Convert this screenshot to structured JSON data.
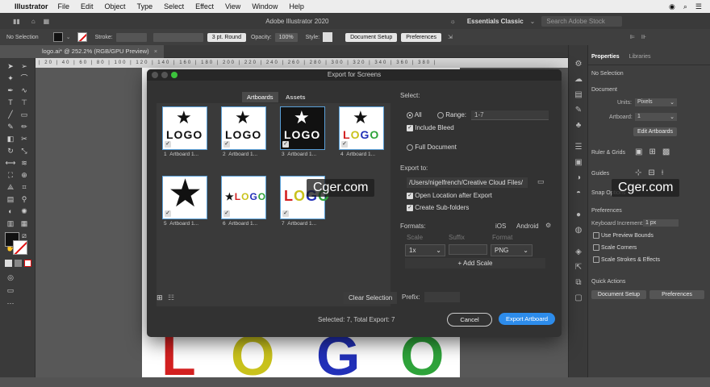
{
  "menubar": {
    "app": "Illustrator",
    "items": [
      "File",
      "Edit",
      "Object",
      "Type",
      "Select",
      "Effect",
      "View",
      "Window",
      "Help"
    ]
  },
  "appbar": {
    "title": "Adobe Illustrator 2020",
    "workspace": "Essentials Classic",
    "search_placeholder": "Search Adobe Stock"
  },
  "control": {
    "selection": "No Selection",
    "stroke_label": "Stroke:",
    "brush": "3 pt. Round",
    "opacity_label": "Opacity:",
    "opacity": "100%",
    "style_label": "Style:",
    "document_setup": "Document Setup",
    "preferences": "Preferences"
  },
  "doc_tab": "logo.ai* @ 252.2% (RGB/GPU Preview)",
  "artboard_letters": {
    "l": "L",
    "o1": "O",
    "g": "G",
    "o2": "O"
  },
  "dialog": {
    "title": "Export for Screens",
    "tabs": [
      "Artboards",
      "Assets"
    ],
    "artboards": [
      {
        "num": "1",
        "label": "Artboard 1..."
      },
      {
        "num": "2",
        "label": "Artboard 1..."
      },
      {
        "num": "3",
        "label": "Artboard 1..."
      },
      {
        "num": "4",
        "label": "Artboard 1..."
      },
      {
        "num": "5",
        "label": "Artboard 1..."
      },
      {
        "num": "6",
        "label": "Artboard 1..."
      },
      {
        "num": "7",
        "label": "Artboard 1..."
      }
    ],
    "logo_word": "LOGO",
    "select_label": "Select:",
    "all": "All",
    "range": "Range:",
    "range_value": "1-7",
    "include_bleed": "Include Bleed",
    "full_document": "Full Document",
    "export_to": "Export to:",
    "path": "/Users/nigelfrench/Creative Cloud Files/",
    "open_location": "Open Location after Export",
    "create_subfolders": "Create Sub-folders",
    "formats": "Formats:",
    "ios": "iOS",
    "android": "Android",
    "col_scale": "Scale",
    "col_suffix": "Suffix",
    "col_format": "Format",
    "scale_value": "1x",
    "format_value": "PNG",
    "add_scale": "+ Add Scale",
    "clear_selection": "Clear Selection",
    "prefix": "Prefix:",
    "status": "Selected: 7, Total Export: 7",
    "cancel": "Cancel",
    "export": "Export Artboard"
  },
  "props": {
    "tabs": [
      "Properties",
      "Libraries"
    ],
    "no_selection": "No Selection",
    "document": "Document",
    "units_label": "Units:",
    "units": "Pixels",
    "artboard_label": "Artboard:",
    "artboard_val": "1",
    "edit_artboards": "Edit Artboards",
    "ruler_grids": "Ruler & Grids",
    "guides": "Guides",
    "snap_options": "Snap Options",
    "preferences": "Preferences",
    "keyboard_inc_label": "Keyboard Increment:",
    "keyboard_inc": "1 px",
    "use_preview": "Use Preview Bounds",
    "scale_corners": "Scale Corners",
    "scale_strokes": "Scale Strokes & Effects",
    "quick_actions": "Quick Actions",
    "doc_setup": "Document Setup",
    "prefs_btn": "Preferences"
  },
  "watermark": "Cger.com",
  "colors": {
    "accent": "#2d8ceb",
    "logo_l": "#d32020",
    "logo_o1": "#c9c21c",
    "logo_g": "#2230b8",
    "logo_o2": "#2ea33a"
  }
}
